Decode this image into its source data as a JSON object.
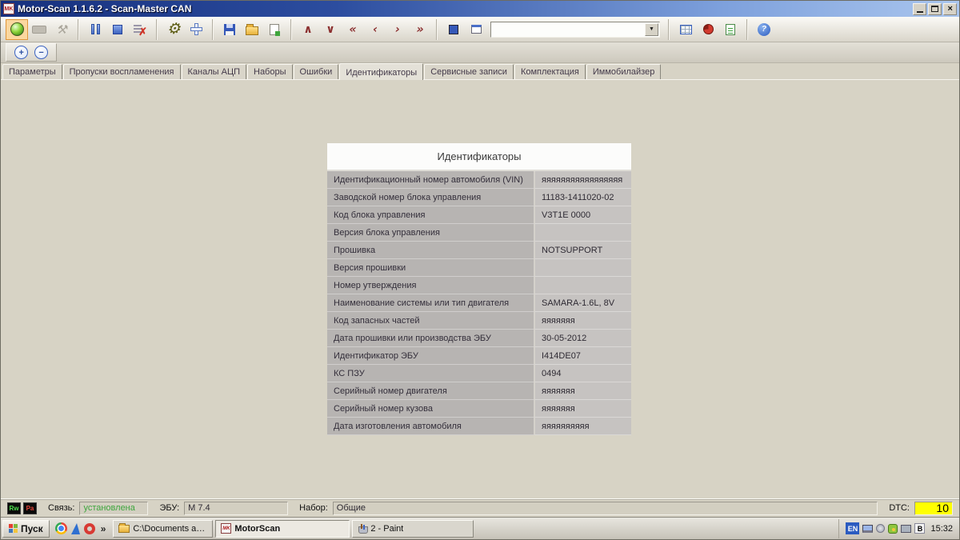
{
  "window": {
    "title": "Motor-Scan 1.1.6.2 - Scan-Master CAN"
  },
  "icons": {
    "close": "×",
    "combo_arrow": "▼",
    "help": "?",
    "tools": "⚒",
    "gear": "⚙",
    "clear_x": "✗",
    "zoom_in": "+",
    "zoom_out": "−",
    "nav_up": "∧",
    "nav_down": "∨",
    "nav_first": "«",
    "nav_prev": "‹",
    "nav_next": "›",
    "nav_last": "»",
    "overflow": "»"
  },
  "toolbar": {
    "combobox_value": ""
  },
  "tabs": {
    "items": [
      "Параметры",
      "Пропуски воспламенения",
      "Каналы АЦП",
      "Наборы",
      "Ошибки",
      "Идентификаторы",
      "Сервисные записи",
      "Комплектация",
      "Иммобилайзер"
    ],
    "active": "Идентификаторы"
  },
  "idpanel": {
    "title": "Идентификаторы",
    "rows": [
      {
        "label": "Идентификационный номер автомобиля (VIN)",
        "value": "яяяяяяяяяяяяяяяяя"
      },
      {
        "label": "Заводской номер блока управления",
        "value": "11183-1411020-02"
      },
      {
        "label": "Код блока управления",
        "value": "V3T1E 0000"
      },
      {
        "label": "Версия блока управления",
        "value": ""
      },
      {
        "label": "Прошивка",
        "value": "NOTSUPPORT"
      },
      {
        "label": "Версия прошивки",
        "value": ""
      },
      {
        "label": "Номер утверждения",
        "value": ""
      },
      {
        "label": "Наименование системы или тип двигателя",
        "value": "SAMARA-1.6L, 8V"
      },
      {
        "label": "Код запасных частей",
        "value": "яяяяяяя"
      },
      {
        "label": "Дата прошивки или производства ЭБУ",
        "value": "30-05-2012"
      },
      {
        "label": "Идентификатор ЭБУ",
        "value": "I414DE07"
      },
      {
        "label": "КС ПЗУ",
        "value": "0494"
      },
      {
        "label": "Серийный номер двигателя",
        "value": "яяяяяяя"
      },
      {
        "label": "Серийный номер кузова",
        "value": "яяяяяяя"
      },
      {
        "label": "Дата изготовления автомобиля",
        "value": "яяяяяяяяяя"
      }
    ]
  },
  "statusbar": {
    "indicator1": "Rw",
    "indicator2": "Pa",
    "link_label": "Связь:",
    "link_value": "установлена",
    "link_color": "#3da53d",
    "ecu_label": "ЭБУ:",
    "ecu_value": "М 7.4",
    "set_label": "Набор:",
    "set_value": "Общие",
    "dtc_label": "DTC:",
    "dtc_value": "10",
    "dtc_bg": "#ffff00"
  },
  "taskbar": {
    "start_label": "Пуск",
    "buttons": [
      {
        "label": "C:\\Documents and Settin..."
      },
      {
        "label": "MotorScan"
      },
      {
        "label": "2 - Paint"
      }
    ],
    "tray": {
      "lang": "EN",
      "keyboard": "B",
      "time": "15:32"
    }
  },
  "app_icon_text": "MK"
}
